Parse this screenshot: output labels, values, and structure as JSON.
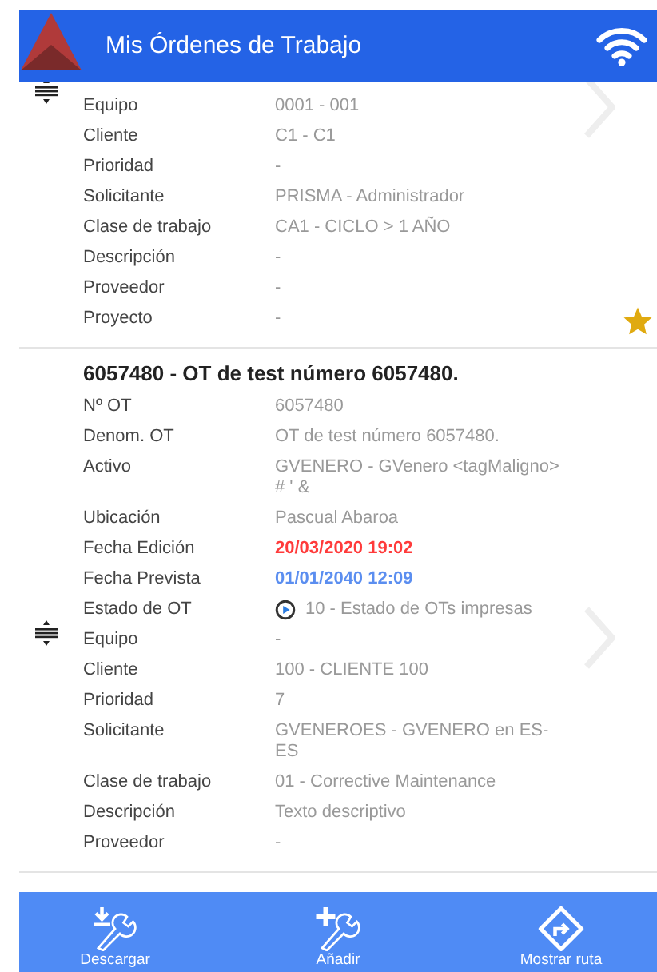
{
  "header": {
    "title": "Mis Órdenes de Trabajo"
  },
  "cards": [
    {
      "favorite": true,
      "fields": [
        {
          "label": "Equipo",
          "value": "0001 - 001",
          "kind": "text"
        },
        {
          "label": "Cliente",
          "value": "C1 - C1",
          "kind": "text"
        },
        {
          "label": "Prioridad",
          "value": "-",
          "kind": "text"
        },
        {
          "label": "Solicitante",
          "value": "PRISMA - Administrador",
          "kind": "text"
        },
        {
          "label": "Clase de trabajo",
          "value": "CA1 - CICLO > 1 AÑO",
          "kind": "text"
        },
        {
          "label": "Descripción",
          "value": "-",
          "kind": "text"
        },
        {
          "label": "Proveedor",
          "value": "-",
          "kind": "text"
        },
        {
          "label": "Proyecto",
          "value": "-",
          "kind": "text"
        }
      ]
    },
    {
      "title": "6057480 - OT de test número 6057480.",
      "fields": [
        {
          "label": "Nº OT",
          "value": "6057480",
          "kind": "text"
        },
        {
          "label": "Denom. OT",
          "value": "OT de test número 6057480.",
          "kind": "text"
        },
        {
          "label": "Activo",
          "value": "GVENERO - GVenero <tagMaligno> # ' &",
          "kind": "text"
        },
        {
          "label": "Ubicación",
          "value": "Pascual Abaroa",
          "kind": "text"
        },
        {
          "label": "Fecha Edición",
          "value": "20/03/2020 19:02",
          "kind": "text",
          "color": "#ff3b3b"
        },
        {
          "label": "Fecha Prevista",
          "value": "01/01/2040 12:09",
          "kind": "text",
          "color": "#5b8ef0"
        },
        {
          "label": "Estado de OT",
          "value": "10 - Estado de OTs impresas",
          "kind": "status"
        },
        {
          "label": "Equipo",
          "value": "-",
          "kind": "text"
        },
        {
          "label": "Cliente",
          "value": "100 - CLIENTE 100",
          "kind": "text"
        },
        {
          "label": "Prioridad",
          "value": "7",
          "kind": "text"
        },
        {
          "label": "Solicitante",
          "value": "GVENEROES - GVENERO en ES-ES",
          "kind": "text"
        },
        {
          "label": "Clase de trabajo",
          "value": "01 - Corrective Maintenance",
          "kind": "text"
        },
        {
          "label": "Descripción",
          "value": "Texto descriptivo",
          "kind": "text"
        },
        {
          "label": "Proveedor",
          "value": "-",
          "kind": "text"
        }
      ]
    }
  ],
  "toolbar": [
    {
      "label": "Descargar",
      "kind": "download"
    },
    {
      "label": "Añadir",
      "kind": "add"
    },
    {
      "label": "Mostrar ruta",
      "kind": "route"
    }
  ]
}
